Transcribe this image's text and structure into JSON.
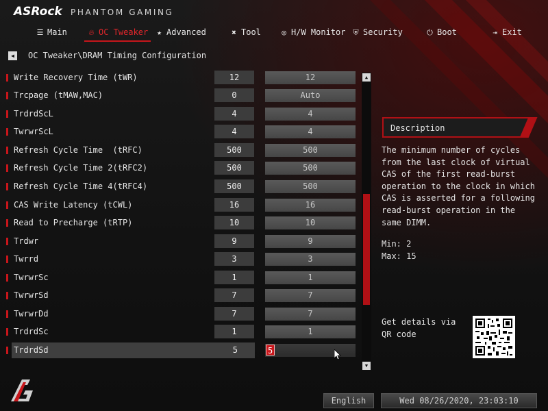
{
  "brand": {
    "logo": "ASRock",
    "subtitle": "PHANTOM GAMING"
  },
  "nav": [
    {
      "label": "Main",
      "icon": "list-icon",
      "active": false
    },
    {
      "label": "OC Tweaker",
      "icon": "flame-icon",
      "active": true
    },
    {
      "label": "Advanced",
      "icon": "star-icon",
      "active": false
    },
    {
      "label": "Tool",
      "icon": "tools-icon",
      "active": false
    },
    {
      "label": "H/W Monitor",
      "icon": "monitor-icon",
      "active": false
    },
    {
      "label": "Security",
      "icon": "shield-icon",
      "active": false
    },
    {
      "label": "Boot",
      "icon": "power-icon",
      "active": false
    },
    {
      "label": "Exit",
      "icon": "exit-icon",
      "active": false
    }
  ],
  "breadcrumb": {
    "back_icon": "back-arrow-icon",
    "path": "OC Tweaker\\DRAM Timing Configuration"
  },
  "settings": [
    {
      "label": "Write Recovery Time (tWR)",
      "current": "12",
      "value": "12"
    },
    {
      "label": "Trcpage (tMAW,MAC)",
      "current": "0",
      "value": "Auto"
    },
    {
      "label": "TrdrdScL",
      "current": "4",
      "value": "4"
    },
    {
      "label": "TwrwrScL",
      "current": "4",
      "value": "4"
    },
    {
      "label": "Refresh Cycle Time  (tRFC)",
      "current": "500",
      "value": "500"
    },
    {
      "label": "Refresh Cycle Time 2(tRFC2)",
      "current": "500",
      "value": "500"
    },
    {
      "label": "Refresh Cycle Time 4(tRFC4)",
      "current": "500",
      "value": "500"
    },
    {
      "label": "CAS Write Latency (tCWL)",
      "current": "16",
      "value": "16"
    },
    {
      "label": "Read to Precharge (tRTP)",
      "current": "10",
      "value": "10"
    },
    {
      "label": "Trdwr",
      "current": "9",
      "value": "9"
    },
    {
      "label": "Twrrd",
      "current": "3",
      "value": "3"
    },
    {
      "label": "TwrwrSc",
      "current": "1",
      "value": "1"
    },
    {
      "label": "TwrwrSd",
      "current": "7",
      "value": "7"
    },
    {
      "label": "TwrwrDd",
      "current": "7",
      "value": "7"
    },
    {
      "label": "TrdrdSc",
      "current": "1",
      "value": "1"
    },
    {
      "label": "TrdrdSd",
      "current": "5",
      "value": "5",
      "selected": true
    }
  ],
  "description": {
    "title": "Description",
    "text": "The minimum number of cycles from the last clock of virtual CAS of the first read-burst operation to the clock in which CAS is asserted for a following read-burst operation in the same DIMM.",
    "min": "Min: 2",
    "max": "Max: 15",
    "qr_label": "Get details via QR code"
  },
  "footer": {
    "language": "English",
    "datetime": "Wed 08/26/2020, 23:03:10"
  },
  "colors": {
    "accent": "#c8161b",
    "background": "#141414",
    "text": "#e6e6e6"
  }
}
